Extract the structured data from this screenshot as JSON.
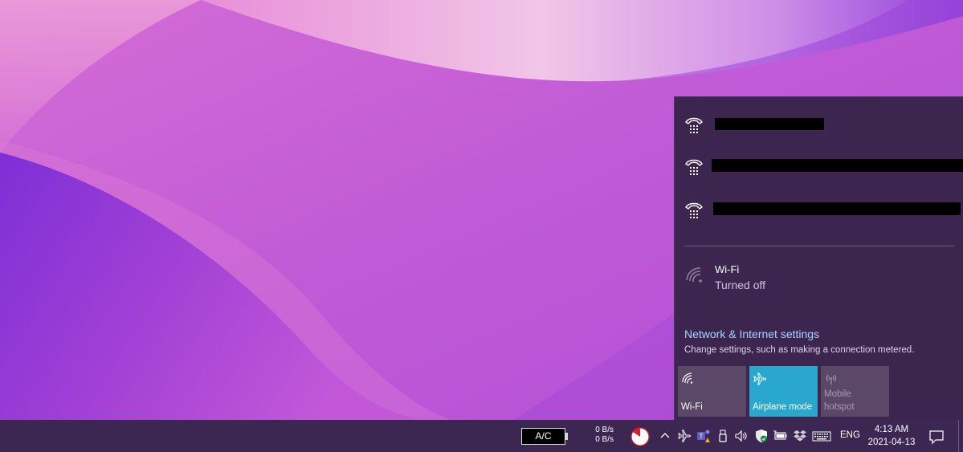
{
  "flyout": {
    "networks": [
      {
        "name": "",
        "redacted": true
      },
      {
        "name": "",
        "redacted": true
      },
      {
        "name": "",
        "redacted": true
      }
    ],
    "wifi": {
      "name": "Wi-Fi",
      "status": "Turned off"
    },
    "settings": {
      "link": "Network & Internet settings",
      "description": "Change settings, such as making a connection metered."
    },
    "tiles": [
      {
        "label": "Wi-Fi",
        "state": "off",
        "icon": "wifi-icon"
      },
      {
        "label": "Airplane mode",
        "state": "on",
        "icon": "airplane-icon"
      },
      {
        "label": "Mobile hotspot",
        "state": "disabled",
        "icon": "hotspot-icon"
      }
    ],
    "accent_color": "#2aa7cc",
    "link_color": "#a8d4ff"
  },
  "taskbar": {
    "power_label": "A/C",
    "net_up": "0 B/s",
    "net_down": "0 B/s",
    "tray_icons": [
      "chevron-up-icon",
      "airplane-icon",
      "teams-icon",
      "usb-icon",
      "volume-icon",
      "security-shield-icon",
      "battery-icon",
      "dropbox-icon",
      "keyboard-icon"
    ],
    "language": "ENG",
    "time": "4:13 AM",
    "date": "2021-04-13"
  }
}
